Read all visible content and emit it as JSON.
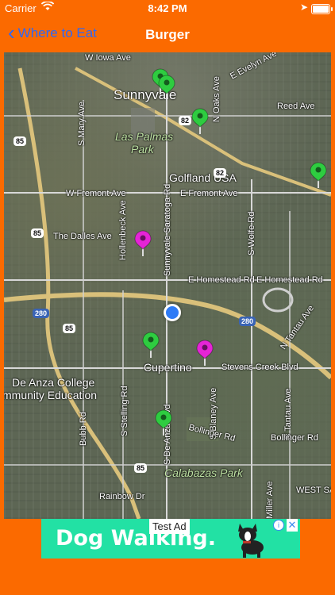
{
  "status": {
    "carrier": "Carrier",
    "time": "8:42 PM"
  },
  "nav": {
    "back_label": "Where to Eat",
    "title": "Burger"
  },
  "map": {
    "labels": {
      "w_iowa": "W Iowa Ave",
      "sunnyvale": "Sunnyvale",
      "e_evelyn": "E Evelyn Ave",
      "s_mary": "S Mary Ave",
      "las_palmas": "Las Palmas\nPark",
      "reed": "Reed Ave",
      "golfland": "Golfland USA",
      "w_fremont": "W Fremont Ave",
      "e_fremont": "E Fremont Ave",
      "dalles": "The Dalles Ave",
      "hollenbeck": "Hollenbeck Ave",
      "saratoga": "Sunnyvale Saratoga Rd",
      "wolfe": "S Wolfe Rd",
      "e_homestead1": "E Homestead Rd",
      "e_homestead2": "E Homestead Rd",
      "n_tantau": "N Tantau Ave",
      "cupertino": "Cupertino",
      "stevens": "Stevens Creek Blvd",
      "deanza1": "De Anza College",
      "deanza2": "mmunity Education",
      "bubb": "Bubb Rd",
      "stelling": "S Stelling Rd",
      "blaney": "S Blaney Ave",
      "s_tantau": "S Tantau Ave",
      "bollinger1": "Bollinger Rd",
      "bollinger2": "Bollinger Rd",
      "deanza_blvd": "S De Anza Blvd",
      "calabazas": "Calabazas Park",
      "rainbow": "Rainbow Dr",
      "miller": "Miller Ave",
      "west_sa": "WEST SA",
      "oaks": "N Oaks Ave"
    },
    "shields": [
      "85",
      "82",
      "82",
      "85",
      "280",
      "280",
      "85",
      "85"
    ],
    "pins": [
      {
        "color": "#2ecc40"
      },
      {
        "color": "#2ecc40"
      },
      {
        "color": "#2ecc40"
      },
      {
        "color": "#2ecc40"
      },
      {
        "color": "#e524d6"
      },
      {
        "color": "#2ecc40"
      },
      {
        "color": "#e524d6"
      },
      {
        "color": "#2ecc40"
      }
    ]
  },
  "ad": {
    "text": "Dog Walking.",
    "badge": "Test Ad"
  }
}
